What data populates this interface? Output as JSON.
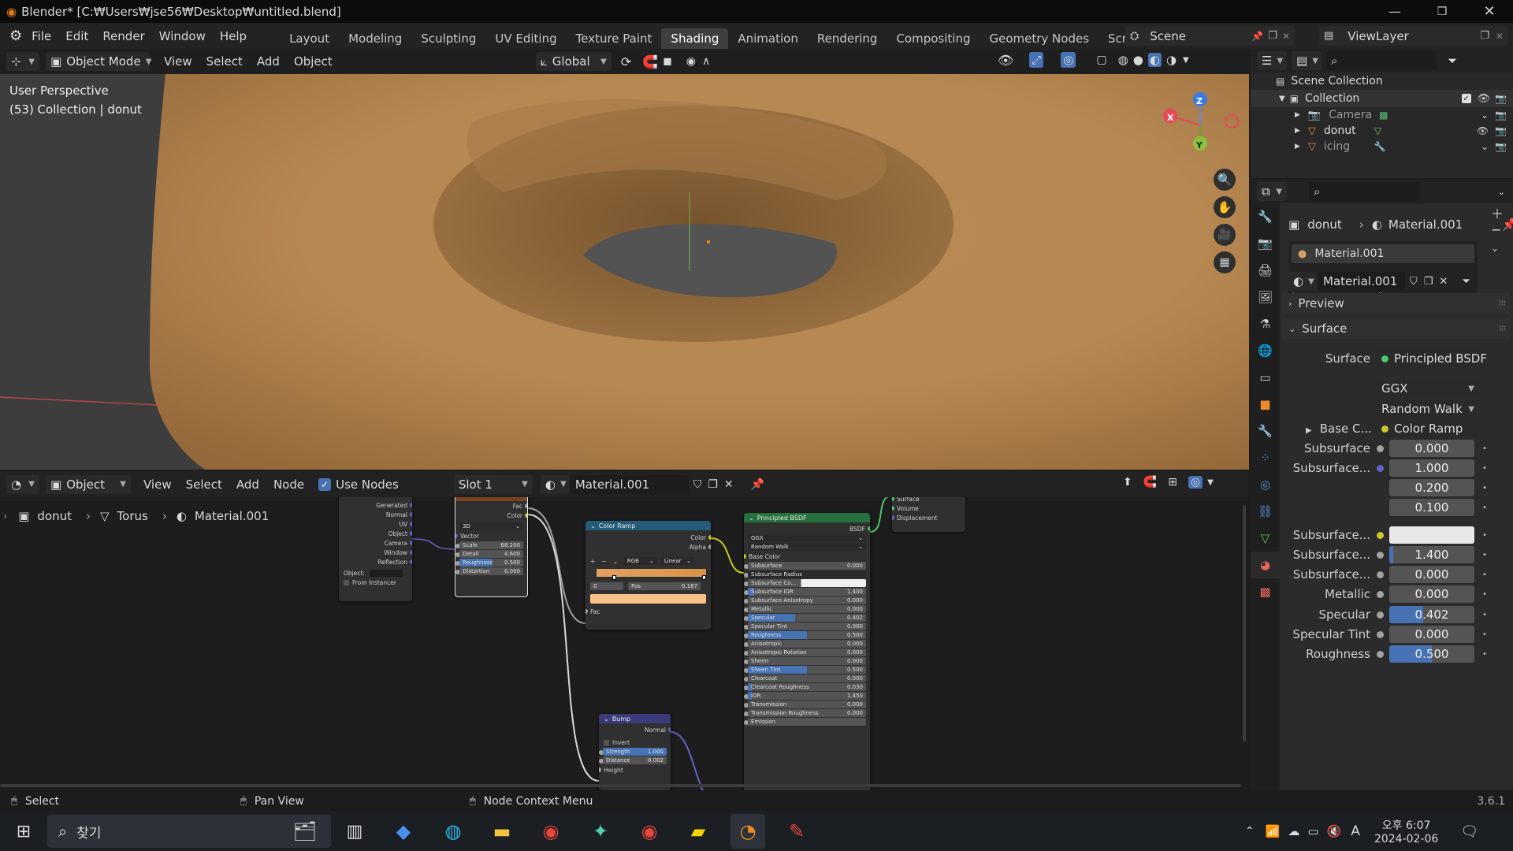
{
  "window": {
    "title": "Blender* [C:₩Users₩jse56₩Desktop₩untitled.blend]"
  },
  "menu": {
    "file": "File",
    "edit": "Edit",
    "render": "Render",
    "window": "Window",
    "help": "Help"
  },
  "workspaces": [
    {
      "label": "Layout",
      "active": false
    },
    {
      "label": "Modeling",
      "active": false
    },
    {
      "label": "Sculpting",
      "active": false
    },
    {
      "label": "UV Editing",
      "active": false
    },
    {
      "label": "Texture Paint",
      "active": false
    },
    {
      "label": "Shading",
      "active": true
    },
    {
      "label": "Animation",
      "active": false
    },
    {
      "label": "Rendering",
      "active": false
    },
    {
      "label": "Compositing",
      "active": false
    },
    {
      "label": "Geometry Nodes",
      "active": false
    },
    {
      "label": "Scripting",
      "active": false
    }
  ],
  "topbar": {
    "add_workspace": "+",
    "scene": "Scene",
    "view_layer": "ViewLayer"
  },
  "viewport": {
    "mode": "Object Mode",
    "view_menu": "View",
    "select_menu": "Select",
    "add_menu": "Add",
    "object_menu": "Object",
    "transform": "Global",
    "overlay_title": "User Perspective",
    "overlay_sub": "(53) Collection | donut",
    "gizmo": {
      "x": "X",
      "y": "Y",
      "z": "Z"
    }
  },
  "node_editor": {
    "type": "Object",
    "view_menu": "View",
    "select_menu": "Select",
    "add_menu": "Add",
    "node_menu": "Node",
    "use_nodes": "Use Nodes",
    "slot": "Slot 1",
    "material": "Material.001",
    "breadcrumb": [
      "donut",
      "Torus",
      "Material.001"
    ],
    "texcoord_outputs": [
      "Generated",
      "Normal",
      "UV",
      "Object",
      "Camera",
      "Window",
      "Reflection"
    ],
    "texcoord_object_label": "Object:",
    "texcoord_from_instancer": "From Instancer",
    "noise": {
      "out_fac": "Fac",
      "out_color": "Color",
      "dim": "3D",
      "vector": "Vector",
      "fields": [
        {
          "label": "Scale",
          "value": "68.200",
          "fill": 0
        },
        {
          "label": "Detail",
          "value": "4.600",
          "fill": 0
        },
        {
          "label": "Roughness",
          "value": "0.500",
          "fill": 0.5
        },
        {
          "label": "Distortion",
          "value": "0.000",
          "fill": 0
        }
      ]
    },
    "color_ramp": {
      "title": "Color Ramp",
      "out_color": "Color",
      "out_alpha": "Alpha",
      "mode": "RGB",
      "interp": "Linear",
      "index": "0",
      "pos_label": "Pos",
      "pos_value": "0.167",
      "in_fac": "Fac"
    },
    "bsdf": {
      "title": "Principled BSDF",
      "out": "BSDF",
      "dist": "GGX",
      "sss": "Random Walk",
      "base_color": "Base Color",
      "fields": [
        {
          "label": "Subsurface",
          "value": "0.000",
          "fill": 0
        },
        {
          "label": "Subsurface Radius",
          "value": "",
          "fill": 0
        },
        {
          "label": "Subsurface Co...",
          "value": "",
          "fill": 0
        },
        {
          "label": "Subsurface IOR",
          "value": "1.400",
          "fill": 0.05
        },
        {
          "label": "Subsurface Anisotropy",
          "value": "0.000",
          "fill": 0
        },
        {
          "label": "Metallic",
          "value": "0.000",
          "fill": 0
        },
        {
          "label": "Specular",
          "value": "0.402",
          "fill": 0.402
        },
        {
          "label": "Specular Tint",
          "value": "0.000",
          "fill": 0
        },
        {
          "label": "Roughness",
          "value": "0.500",
          "fill": 0.5
        },
        {
          "label": "Anisotropic",
          "value": "0.000",
          "fill": 0
        },
        {
          "label": "Anisotropic Rotation",
          "value": "0.000",
          "fill": 0
        },
        {
          "label": "Sheen",
          "value": "0.000",
          "fill": 0
        },
        {
          "label": "Sheen Tint",
          "value": "0.500",
          "fill": 0.5
        },
        {
          "label": "Clearcoat",
          "value": "0.000",
          "fill": 0
        },
        {
          "label": "Clearcoat Roughness",
          "value": "0.030",
          "fill": 0.03
        },
        {
          "label": "IOR",
          "value": "1.450",
          "fill": 0.03
        },
        {
          "label": "Transmission",
          "value": "0.000",
          "fill": 0
        },
        {
          "label": "Transmission Roughness",
          "value": "0.000",
          "fill": 0
        },
        {
          "label": "Emission",
          "value": "",
          "fill": 0
        }
      ]
    },
    "output": {
      "inputs": [
        "Surface",
        "Volume",
        "Displacement"
      ]
    },
    "bump": {
      "title": "Bump",
      "out": "Normal",
      "invert": "Invert",
      "fields": [
        {
          "label": "Strength",
          "value": "1.000",
          "fill": 1
        },
        {
          "label": "Distance",
          "value": "0.002",
          "fill": 0
        }
      ],
      "height": "Height"
    }
  },
  "outliner": {
    "scene_collection": "Scene Collection",
    "collection": "Collection",
    "items": [
      {
        "label": "Camera"
      },
      {
        "label": "donut"
      },
      {
        "label": "icing"
      }
    ]
  },
  "properties": {
    "breadcrumb_object": "donut",
    "breadcrumb_material": "Material.001",
    "slot_item": "Material.001",
    "material_name": "Material.001",
    "preview": "Preview",
    "surface_panel": "Surface",
    "surface_label": "Surface",
    "surface_value": "Principled BSDF",
    "distribution": "GGX",
    "sss_method": "Random Walk",
    "base_color_label": "Base C...",
    "base_color_value": "Color Ramp",
    "rows": [
      {
        "label": "Subsurface",
        "value": "0.000",
        "fill": 0,
        "dot": "#a1a1a1"
      },
      {
        "label": "Subsurface...",
        "value": "1.000",
        "fill": 0,
        "dot": "#6363c7"
      },
      {
        "label": "",
        "value": "0.200",
        "fill": 0,
        "dot": ""
      },
      {
        "label": "",
        "value": "0.100",
        "fill": 0,
        "dot": ""
      },
      {
        "label": "Subsurface...",
        "value": "",
        "fill": 0,
        "dot": "#c7c729",
        "white": true
      },
      {
        "label": "Subsurface...",
        "value": "1.400",
        "fill": 0.05,
        "dot": "#a1a1a1"
      },
      {
        "label": "Subsurface...",
        "value": "0.000",
        "fill": 0,
        "dot": "#a1a1a1"
      },
      {
        "label": "Metallic",
        "value": "0.000",
        "fill": 0,
        "dot": "#a1a1a1"
      },
      {
        "label": "Specular",
        "value": "0.402",
        "fill": 0.402,
        "dot": "#a1a1a1"
      },
      {
        "label": "Specular Tint",
        "value": "0.000",
        "fill": 0,
        "dot": "#a1a1a1"
      },
      {
        "label": "Roughness",
        "value": "0.500",
        "fill": 0.5,
        "dot": "#a1a1a1"
      }
    ]
  },
  "statusbar": {
    "select": "Select",
    "pan": "Pan View",
    "context": "Node Context Menu",
    "version": "3.6.1"
  },
  "taskbar": {
    "search": "찾기",
    "time": "오후 6:07",
    "date": "2024-02-06",
    "ime": "A"
  }
}
